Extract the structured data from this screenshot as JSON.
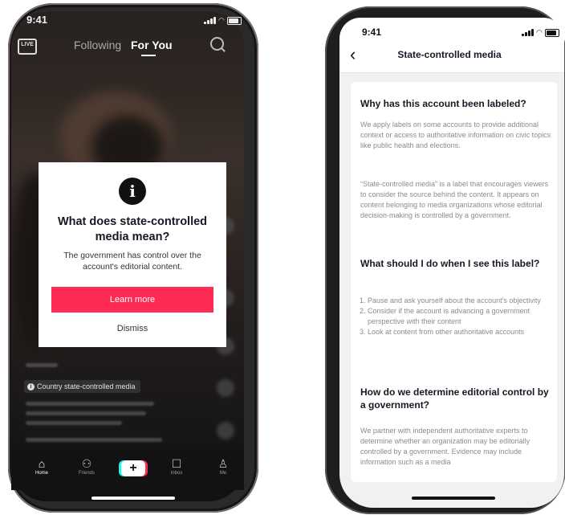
{
  "left_phone": {
    "status_time": "9:41",
    "live_label": "LIVE",
    "tabs": [
      "Following",
      "For You"
    ],
    "modal": {
      "icon": "info-icon",
      "title": "What does state-controlled media mean?",
      "body": "The government has control over the account's editorial content.",
      "primary_button": "Learn more",
      "secondary_button": "Dismiss",
      "primary_color": "#fe2c55"
    },
    "country_label": "Country state-controlled media",
    "bottom_nav": [
      {
        "label": "Home",
        "icon": "home-icon"
      },
      {
        "label": "Friends",
        "icon": "friends-icon"
      },
      {
        "label": "",
        "icon": "plus-icon"
      },
      {
        "label": "Inbox",
        "icon": "inbox-icon"
      },
      {
        "label": "Me",
        "icon": "profile-icon"
      }
    ]
  },
  "right_phone": {
    "status_time": "9:41",
    "title": "State-controlled media",
    "section1": {
      "heading": "Why has this account been labeled?",
      "p1": "We apply labels on some accounts to provide additional context or access to authoritative information on civic topics like public health and elections.",
      "p2": "“State-controlled media” is a label that encourages viewers to consider the source behind the content. It appears on content belonging to media organizations whose editorial decision-making is controlled by a government."
    },
    "section2": {
      "heading": "What should I do when I see this label?",
      "items": [
        "Pause and ask yourself about the account's objectivity",
        "Consider if the account is advancing a government perspective with their content",
        "Look at content from other authoritative accounts"
      ]
    },
    "section3": {
      "heading": "How do we determine editorial control by a government?",
      "p1": "We partner with independent authoritative experts to determine whether an organization may be editorially controlled by a government. Evidence may include information such as a media"
    }
  }
}
